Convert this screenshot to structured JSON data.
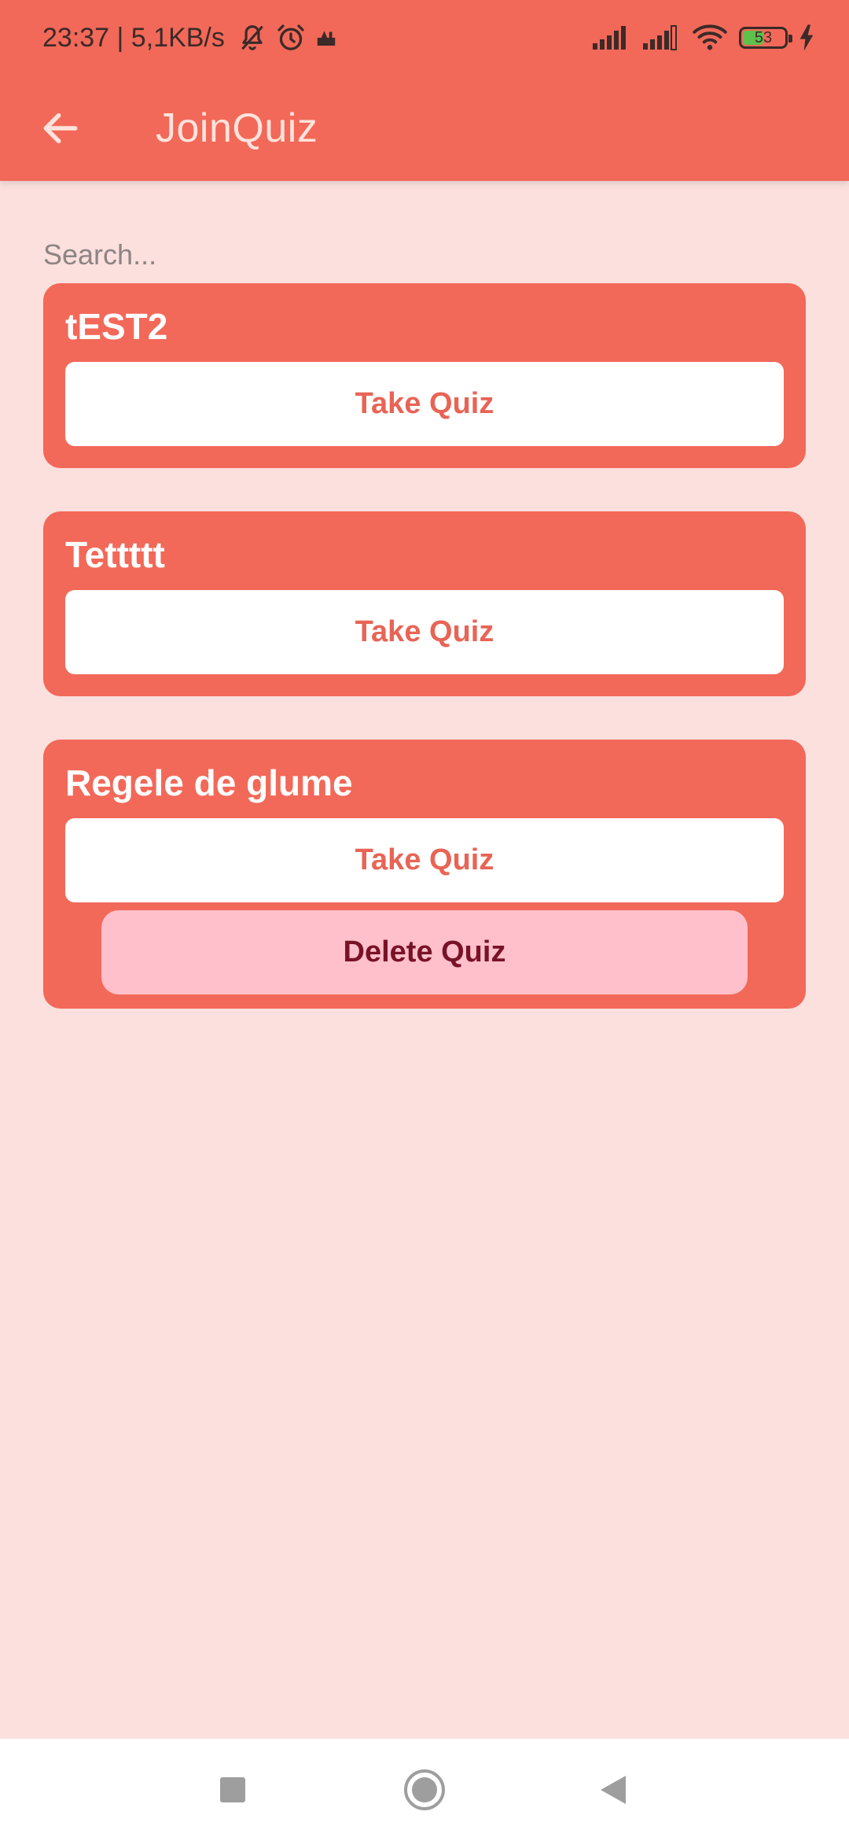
{
  "status_bar": {
    "time_text": "23:37 | 5,1KB/s",
    "battery_level": "53",
    "icons": [
      "bell-off-icon",
      "alarm-icon",
      "app-notification-icon",
      "cellular-signal-icon",
      "cellular-signal-icon",
      "wifi-icon",
      "battery-icon",
      "charging-icon"
    ]
  },
  "app_bar": {
    "title": "JoinQuiz",
    "back_icon": "arrow-left-icon"
  },
  "search": {
    "placeholder": "Search...",
    "value": ""
  },
  "quizzes": [
    {
      "title": "tEST2",
      "take_label": "Take Quiz"
    },
    {
      "title": "Tettttt",
      "take_label": "Take Quiz"
    },
    {
      "title": "Regele de glume",
      "take_label": "Take Quiz",
      "delete_label": "Delete Quiz"
    }
  ],
  "nav_bar": {
    "icons": [
      "recents-square-icon",
      "home-circle-icon",
      "back-triangle-icon"
    ]
  },
  "colors": {
    "primary": "#F26959",
    "background": "#FBE0DE",
    "title_text": "#FFE3DC",
    "button_bg": "#FFFFFF",
    "button_text": "#E86456",
    "delete_bg": "#FFC0CB",
    "delete_text": "#7A1227"
  }
}
